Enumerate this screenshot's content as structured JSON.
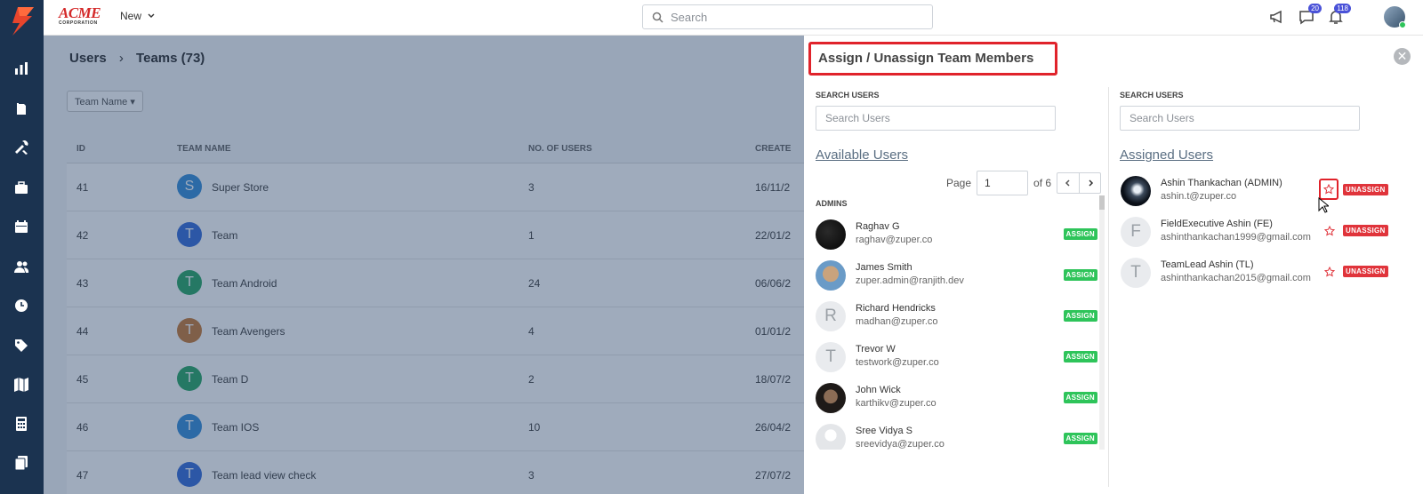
{
  "topbar": {
    "brand_main": "ACME",
    "brand_sub": "CORPORATION",
    "new_label": "New",
    "search_placeholder": "Search",
    "chat_badge": "20",
    "notif_badge": "118"
  },
  "sidebar_icons": [
    "dashboard-icon",
    "clipboard-icon",
    "tools-icon",
    "briefcase-icon",
    "calendar-icon",
    "users-icon",
    "clock-icon",
    "tag-icon",
    "map-icon",
    "calculator-icon",
    "documents-icon"
  ],
  "background": {
    "breadcrumb": [
      "Users",
      "Teams (73)"
    ],
    "filter_label": "Team Name",
    "columns": [
      "ID",
      "TEAM NAME",
      "NO. OF USERS",
      "CREATE"
    ],
    "rows": [
      {
        "id": "41",
        "initial": "S",
        "name": "Super Store",
        "users": "3",
        "created": "16/11/2",
        "color": "#3a8fd9"
      },
      {
        "id": "42",
        "initial": "T",
        "name": "Team",
        "users": "1",
        "created": "22/01/2",
        "color": "#3a6fd9"
      },
      {
        "id": "43",
        "initial": "T",
        "name": "Team Android",
        "users": "24",
        "created": "06/06/2",
        "color": "#2ea868"
      },
      {
        "id": "44",
        "initial": "T",
        "name": "Team Avengers",
        "users": "4",
        "created": "01/01/2",
        "color": "#c97c3a"
      },
      {
        "id": "45",
        "initial": "T",
        "name": "Team D",
        "users": "2",
        "created": "18/07/2",
        "color": "#2ea868"
      },
      {
        "id": "46",
        "initial": "T",
        "name": "Team IOS",
        "users": "10",
        "created": "26/04/2",
        "color": "#3a8fd9"
      },
      {
        "id": "47",
        "initial": "T",
        "name": "Team lead view check",
        "users": "3",
        "created": "27/07/2",
        "color": "#3a6fd9"
      }
    ]
  },
  "modal": {
    "title": "Assign / Unassign Team Members",
    "left": {
      "search_label": "SEARCH USERS",
      "search_placeholder": "Search Users",
      "section_title": "Available Users",
      "page_label": "Page",
      "page_value": "1",
      "page_of": "of 6",
      "group_label": "ADMINS",
      "assign_label": "ASSIGN",
      "users": [
        {
          "name": "Raghav G",
          "email": "raghav@zuper.co",
          "initial": "",
          "avatar": "dark"
        },
        {
          "name": "James Smith",
          "email": "zuper.admin@ranjith.dev",
          "initial": "",
          "avatar": "photo-blue"
        },
        {
          "name": "Richard Hendricks",
          "email": "madhan@zuper.co",
          "initial": "R",
          "avatar": "letter"
        },
        {
          "name": "Trevor W",
          "email": "testwork@zuper.co",
          "initial": "T",
          "avatar": "letter"
        },
        {
          "name": "John Wick",
          "email": "karthikv@zuper.co",
          "initial": "",
          "avatar": "photo-dark"
        },
        {
          "name": "Sree Vidya S",
          "email": "sreevidya@zuper.co",
          "initial": "",
          "avatar": "placeholder"
        }
      ]
    },
    "right": {
      "search_label": "SEARCH USERS",
      "search_placeholder": "Search Users",
      "section_title": "Assigned Users",
      "unassign_label": "UNASSIGN",
      "users": [
        {
          "name": "Ashin Thankachan (ADMIN)",
          "email": "ashin.t@zuper.co",
          "initial": "",
          "avatar": "photo-space"
        },
        {
          "name": "FieldExecutive Ashin (FE)",
          "email": "ashinthankachan1999@gmail.com",
          "initial": "F",
          "avatar": "letter"
        },
        {
          "name": "TeamLead Ashin (TL)",
          "email": "ashinthankachan2015@gmail.com",
          "initial": "T",
          "avatar": "letter"
        }
      ]
    }
  }
}
